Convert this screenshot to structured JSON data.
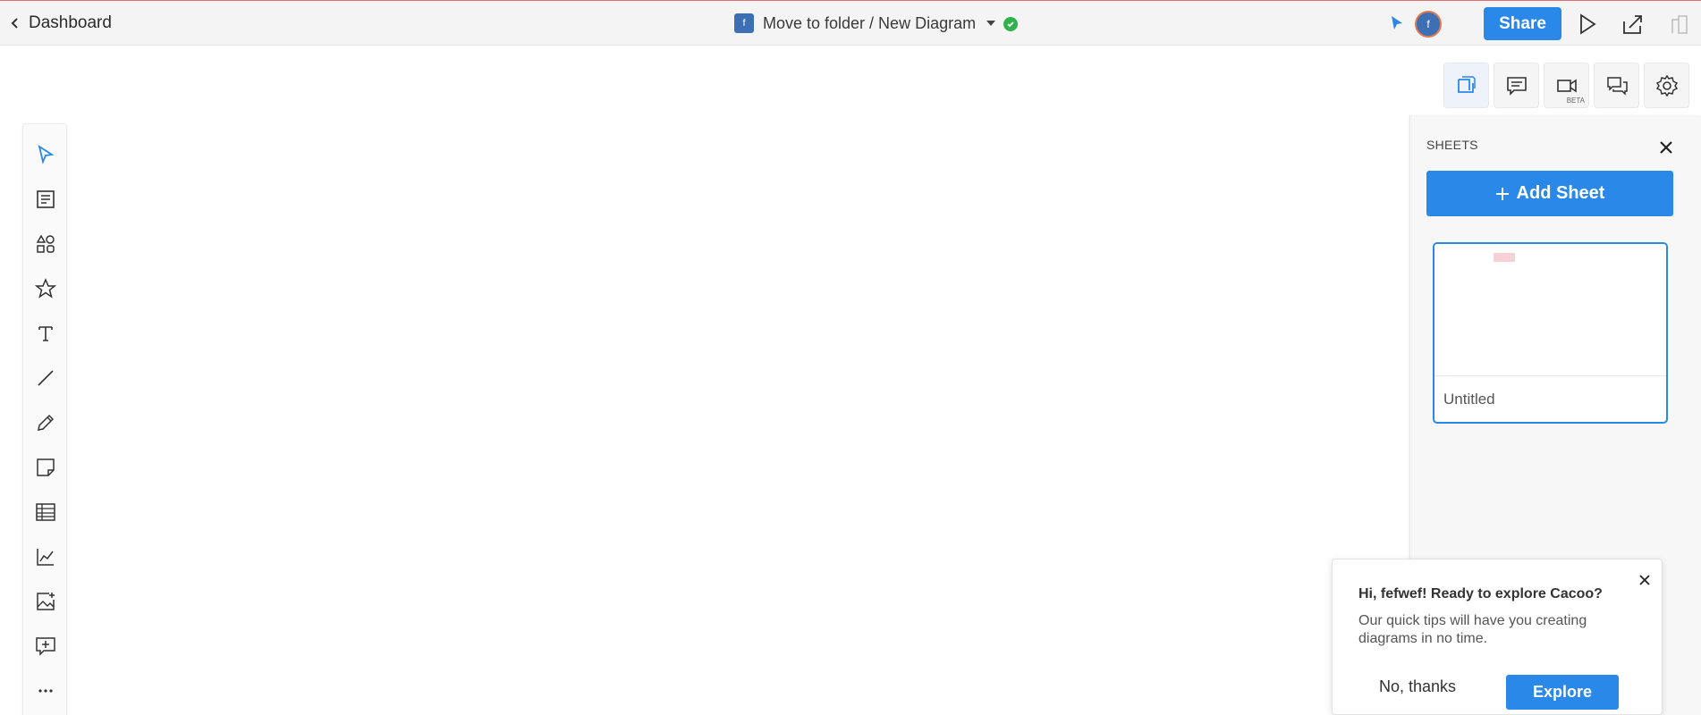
{
  "header": {
    "back_label": "Dashboard",
    "folder_badge": "f",
    "breadcrumb": "Move to folder / New Diagram",
    "avatar_initial": "f",
    "share_label": "Share"
  },
  "right_toolbar": {
    "items": [
      {
        "icon": "sheets-icon"
      },
      {
        "icon": "comments-icon"
      },
      {
        "icon": "video-icon",
        "badge": "BETA"
      },
      {
        "icon": "chat-icon"
      },
      {
        "icon": "gear-icon"
      }
    ]
  },
  "left_toolbar": {
    "items": [
      "select",
      "template",
      "shapes",
      "favorites",
      "text",
      "line",
      "pen",
      "sticky-note",
      "table",
      "chart",
      "image",
      "comment",
      "more"
    ]
  },
  "sheets_panel": {
    "title": "SHEETS",
    "add_label": "Add Sheet",
    "sheets": [
      {
        "name": "Untitled"
      }
    ]
  },
  "tip": {
    "title": "Hi, fefwef! Ready to explore Cacoo?",
    "body": "Our quick tips will have you creating diagrams in no time.",
    "no_label": "No, thanks",
    "explore_label": "Explore"
  },
  "colors": {
    "accent": "#2a88e8",
    "saved": "#2fb24c"
  }
}
